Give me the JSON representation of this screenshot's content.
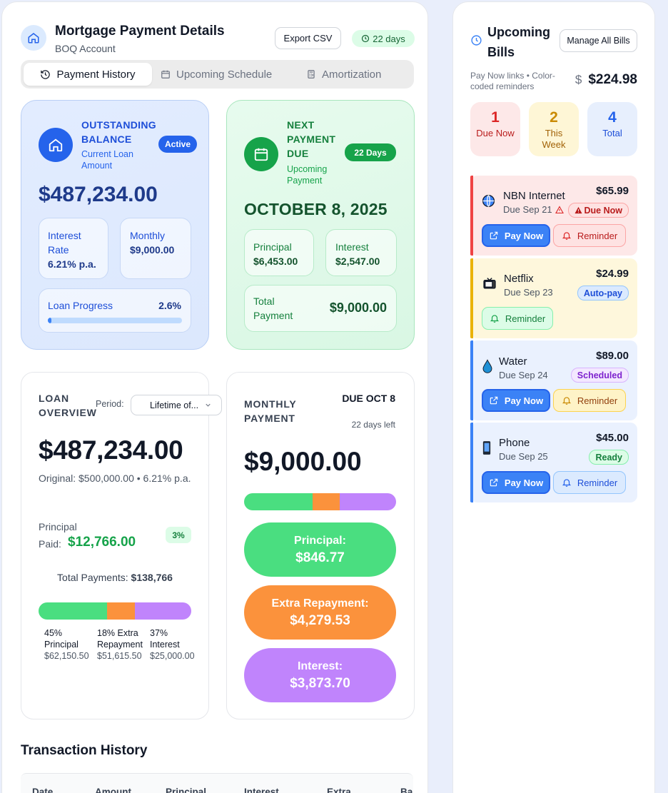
{
  "header": {
    "title": "Mortgage Payment Details",
    "subtitle": "BOQ Account",
    "export_label": "Export CSV",
    "days_label": "22 days"
  },
  "tabs": [
    {
      "label": "Payment History",
      "active": true
    },
    {
      "label": "Upcoming Schedule",
      "active": false
    },
    {
      "label": "Amortization",
      "active": false
    }
  ],
  "outstanding": {
    "title": "OUTSTANDING BALANCE",
    "subtitle": "Current Loan Amount",
    "badge": "Active",
    "amount": "$487,234.00",
    "rate_label": "Interest Rate",
    "rate_value": "6.21% p.a.",
    "monthly_label": "Monthly",
    "monthly_value": "$9,000.00",
    "progress_label": "Loan Progress",
    "progress_value": "2.6%",
    "progress_fraction": 0.026
  },
  "next_payment": {
    "title": "NEXT PAYMENT DUE",
    "subtitle": "Upcoming Payment",
    "badge": "22 Days",
    "date": "OCTOBER 8, 2025",
    "principal_label": "Principal",
    "principal_value": "$6,453.00",
    "interest_label": "Interest",
    "interest_value": "$2,547.00",
    "total_label": "Total Payment",
    "total_value": "$9,000.00"
  },
  "loan_overview": {
    "title": "LOAN OVERVIEW",
    "period_label": "Period:",
    "period_value": "Lifetime of...",
    "amount": "$487,234.00",
    "original": "Original: $500,000.00 • 6.21% p.a.",
    "principal_paid_label": "Principal Paid:",
    "principal_paid_value": "$12,766.00",
    "principal_pct": "3%",
    "total_payments_label": "Total Payments:",
    "total_payments_value": "$138,766",
    "breakdown": [
      {
        "pct": "45%",
        "label": "Principal",
        "value": "$62,150.50",
        "fraction": 0.45,
        "color": "#4ade80"
      },
      {
        "pct": "18%",
        "label": "Extra Repayment",
        "value": "$51,615.50",
        "fraction": 0.18,
        "color": "#fb923c"
      },
      {
        "pct": "37%",
        "label": "Interest",
        "value": "$25,000.00",
        "fraction": 0.37,
        "color": "#c084fc"
      }
    ]
  },
  "monthly_payment": {
    "title": "MONTHLY PAYMENT",
    "due": "DUE OCT 8",
    "days_left": "22 days left",
    "amount": "$9,000.00",
    "segments": [
      {
        "label": "Principal:",
        "value": "$846.77",
        "fraction": 0.45,
        "color": "#4ade80"
      },
      {
        "label": "Extra Repayment:",
        "value": "$4,279.53",
        "fraction": 0.18,
        "color": "#fb923c"
      },
      {
        "label": "Interest:",
        "value": "$3,873.70",
        "fraction": 0.37,
        "color": "#c084fc"
      }
    ]
  },
  "transaction_history": {
    "title": "Transaction History",
    "columns": [
      "Date",
      "Amount",
      "Principal",
      "Interest",
      "Extra",
      "Ba"
    ]
  },
  "bills": {
    "title": "Upcoming Bills",
    "manage_label": "Manage All Bills",
    "subtitle": "Pay Now links • Color-coded reminders",
    "total": "$224.98",
    "dollar_glyph": "$",
    "stats": [
      {
        "n": "1",
        "label": "Due Now"
      },
      {
        "n": "2",
        "label": "This Week"
      },
      {
        "n": "4",
        "label": "Total"
      }
    ],
    "items": [
      {
        "name": "NBN Internet",
        "due": "Due Sep 21",
        "amount": "$65.99",
        "tag": "Due Now",
        "pay_label": "Pay Now",
        "reminder_label": "Reminder"
      },
      {
        "name": "Netflix",
        "due": "Due Sep 23",
        "amount": "$24.99",
        "tag": "Auto-pay",
        "reminder_label": "Reminder"
      },
      {
        "name": "Water",
        "due": "Due Sep 24",
        "amount": "$89.00",
        "tag": "Scheduled",
        "pay_label": "Pay Now",
        "reminder_label": "Reminder"
      },
      {
        "name": "Phone",
        "due": "Due Sep 25",
        "amount": "$45.00",
        "tag": "Ready",
        "pay_label": "Pay Now",
        "reminder_label": "Reminder"
      }
    ]
  }
}
